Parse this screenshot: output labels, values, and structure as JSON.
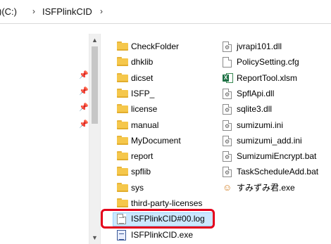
{
  "address_bar": {
    "drive_label": ")(C:)",
    "folder": "ISFPlinkCID",
    "separator": "›"
  },
  "files_left": [
    {
      "name": "CheckFolder",
      "icon": "folder-icon"
    },
    {
      "name": "dhklib",
      "icon": "folder-icon"
    },
    {
      "name": "dicset",
      "icon": "folder-icon"
    },
    {
      "name": "ISFP_",
      "icon": "folder-icon"
    },
    {
      "name": "license",
      "icon": "folder-icon"
    },
    {
      "name": "manual",
      "icon": "folder-icon"
    },
    {
      "name": "MyDocument",
      "icon": "folder-icon"
    },
    {
      "name": "report",
      "icon": "folder-icon"
    },
    {
      "name": "spflib",
      "icon": "folder-icon"
    },
    {
      "name": "sys",
      "icon": "folder-icon"
    },
    {
      "name": "third-party-licenses",
      "icon": "folder-icon"
    },
    {
      "name": "ISFPlinkCID#00.log",
      "icon": "text-file-icon"
    },
    {
      "name": "ISFPlinkCID.exe",
      "icon": "app-exe-icon"
    }
  ],
  "files_right": [
    {
      "name": "jvrapi101.dll",
      "icon": "dll-file-icon"
    },
    {
      "name": "PolicySetting.cfg",
      "icon": "blank-file-icon"
    },
    {
      "name": "ReportTool.xlsm",
      "icon": "excel-file-icon"
    },
    {
      "name": "SpflApi.dll",
      "icon": "dll-file-icon"
    },
    {
      "name": "sqlite3.dll",
      "icon": "dll-file-icon"
    },
    {
      "name": "sumizumi.ini",
      "icon": "ini-file-icon"
    },
    {
      "name": "sumizumi_add.ini",
      "icon": "ini-file-icon"
    },
    {
      "name": "SumizumiEncrypt.bat",
      "icon": "bat-file-icon"
    },
    {
      "name": "TaskScheduleAdd.bat",
      "icon": "bat-file-icon"
    },
    {
      "name": "すみずみ君.exe",
      "icon": "sumizumi-app-icon"
    }
  ],
  "highlight_color": "#e4001b",
  "folder_color": "#f5c74b",
  "selection_color": "#cce8ff"
}
